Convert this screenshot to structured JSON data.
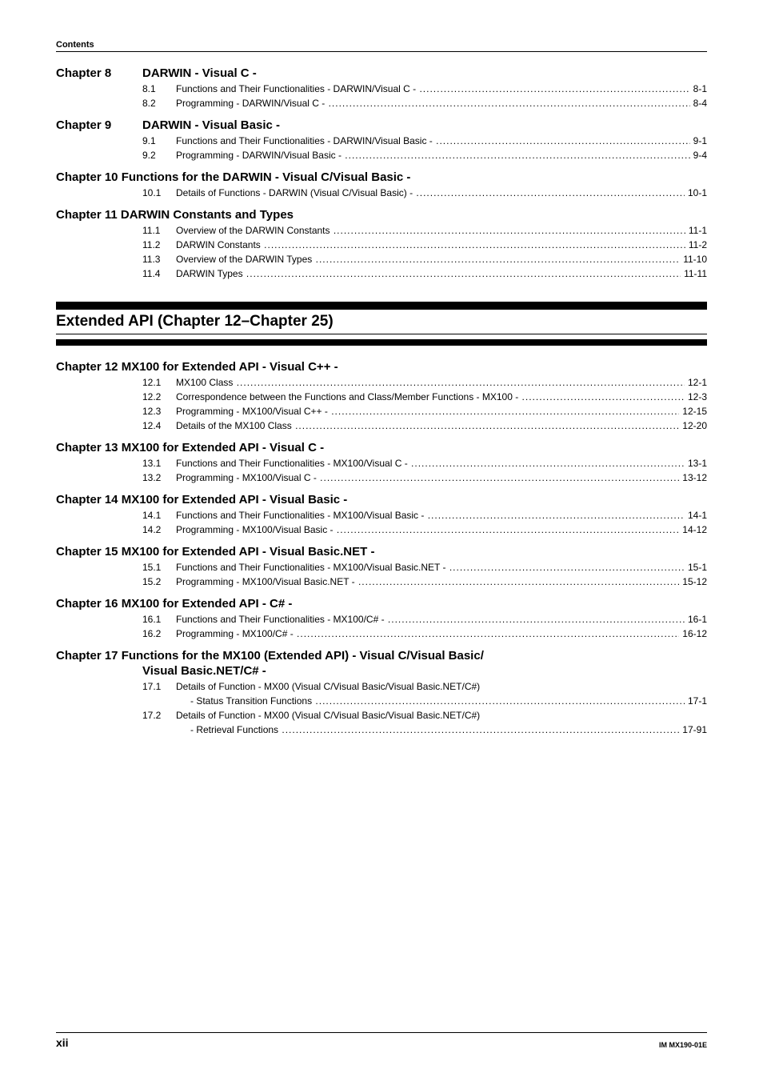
{
  "running_head": "Contents",
  "chapters_top": [
    {
      "label": "Chapter 8",
      "title": "DARWIN - Visual C -",
      "entries": [
        {
          "num": "8.1",
          "title": "Functions and Their Functionalities - DARWIN/Visual C -",
          "page": "8-1"
        },
        {
          "num": "8.2",
          "title": "Programming - DARWIN/Visual C -",
          "page": "8-4"
        }
      ]
    },
    {
      "label": "Chapter 9",
      "title": "DARWIN - Visual Basic -",
      "entries": [
        {
          "num": "9.1",
          "title": "Functions and Their Functionalities - DARWIN/Visual Basic -",
          "page": "9-1"
        },
        {
          "num": "9.2",
          "title": "Programming - DARWIN/Visual Basic -",
          "page": "9-4"
        }
      ]
    },
    {
      "full_heading": "Chapter 10 Functions for the DARWIN - Visual C/Visual Basic -",
      "entries": [
        {
          "num": "10.1",
          "title": "Details of Functions - DARWIN (Visual C/Visual Basic) -",
          "page": "10-1"
        }
      ]
    },
    {
      "full_heading": "Chapter 11 DARWIN Constants and Types",
      "entries": [
        {
          "num": "11.1",
          "title": "Overview of the DARWIN Constants",
          "page": "11-1"
        },
        {
          "num": "11.2",
          "title": "DARWIN Constants",
          "page": "11-2"
        },
        {
          "num": "11.3",
          "title": "Overview of the DARWIN Types",
          "page": "11-10"
        },
        {
          "num": "11.4",
          "title": "DARWIN Types",
          "page": "11-11"
        }
      ]
    }
  ],
  "part_heading": "Extended API (Chapter 12–Chapter 25)",
  "chapters_bottom": [
    {
      "full_heading": "Chapter 12 MX100 for Extended API - Visual C++ -",
      "entries": [
        {
          "num": "12.1",
          "title": "MX100 Class",
          "page": "12-1"
        },
        {
          "num": "12.2",
          "title": "Correspondence between the Functions and Class/Member Functions - MX100 -",
          "page": "12-3"
        },
        {
          "num": "12.3",
          "title": "Programming - MX100/Visual C++ -",
          "page": "12-15"
        },
        {
          "num": "12.4",
          "title": "Details of the MX100 Class",
          "page": "12-20"
        }
      ]
    },
    {
      "full_heading": "Chapter 13 MX100 for Extended API - Visual C -",
      "entries": [
        {
          "num": "13.1",
          "title": "Functions and Their Functionalities - MX100/Visual C -",
          "page": "13-1"
        },
        {
          "num": "13.2",
          "title": "Programming - MX100/Visual C -",
          "page": "13-12"
        }
      ]
    },
    {
      "full_heading": "Chapter 14 MX100 for Extended API - Visual Basic -",
      "entries": [
        {
          "num": "14.1",
          "title": "Functions and Their Functionalities - MX100/Visual Basic -",
          "page": "14-1"
        },
        {
          "num": "14.2",
          "title": "Programming - MX100/Visual Basic -",
          "page": "14-12"
        }
      ]
    },
    {
      "full_heading": "Chapter 15 MX100 for Extended API - Visual Basic.NET -",
      "entries": [
        {
          "num": "15.1",
          "title": "Functions and Their Functionalities - MX100/Visual Basic.NET -",
          "page": "15-1"
        },
        {
          "num": "15.2",
          "title": "Programming - MX100/Visual Basic.NET -",
          "page": "15-12"
        }
      ]
    },
    {
      "full_heading": "Chapter 16 MX100 for Extended API - C# -",
      "entries": [
        {
          "num": "16.1",
          "title": "Functions and Their Functionalities - MX100/C# -",
          "page": "16-1"
        },
        {
          "num": "16.2",
          "title": "Programming - MX100/C# -",
          "page": "16-12"
        }
      ]
    },
    {
      "full_heading": "Chapter 17 Functions for the MX100 (Extended API) - Visual C/Visual Basic/",
      "indent_title": "Visual Basic.NET/C# -",
      "entries": [
        {
          "num": "17.1",
          "title_noleader": "Details of  Function - MX00 (Visual C/Visual Basic/Visual Basic.NET/C#)",
          "sub": "- Status Transition Functions",
          "page": "17-1"
        },
        {
          "num": "17.2",
          "title_noleader": "Details of  Function - MX00 (Visual C/Visual Basic/Visual Basic.NET/C#)",
          "sub": "- Retrieval Functions",
          "page": "17-91"
        }
      ]
    }
  ],
  "footer": {
    "page_roman": "xii",
    "doc_code": "IM MX190-01E"
  }
}
